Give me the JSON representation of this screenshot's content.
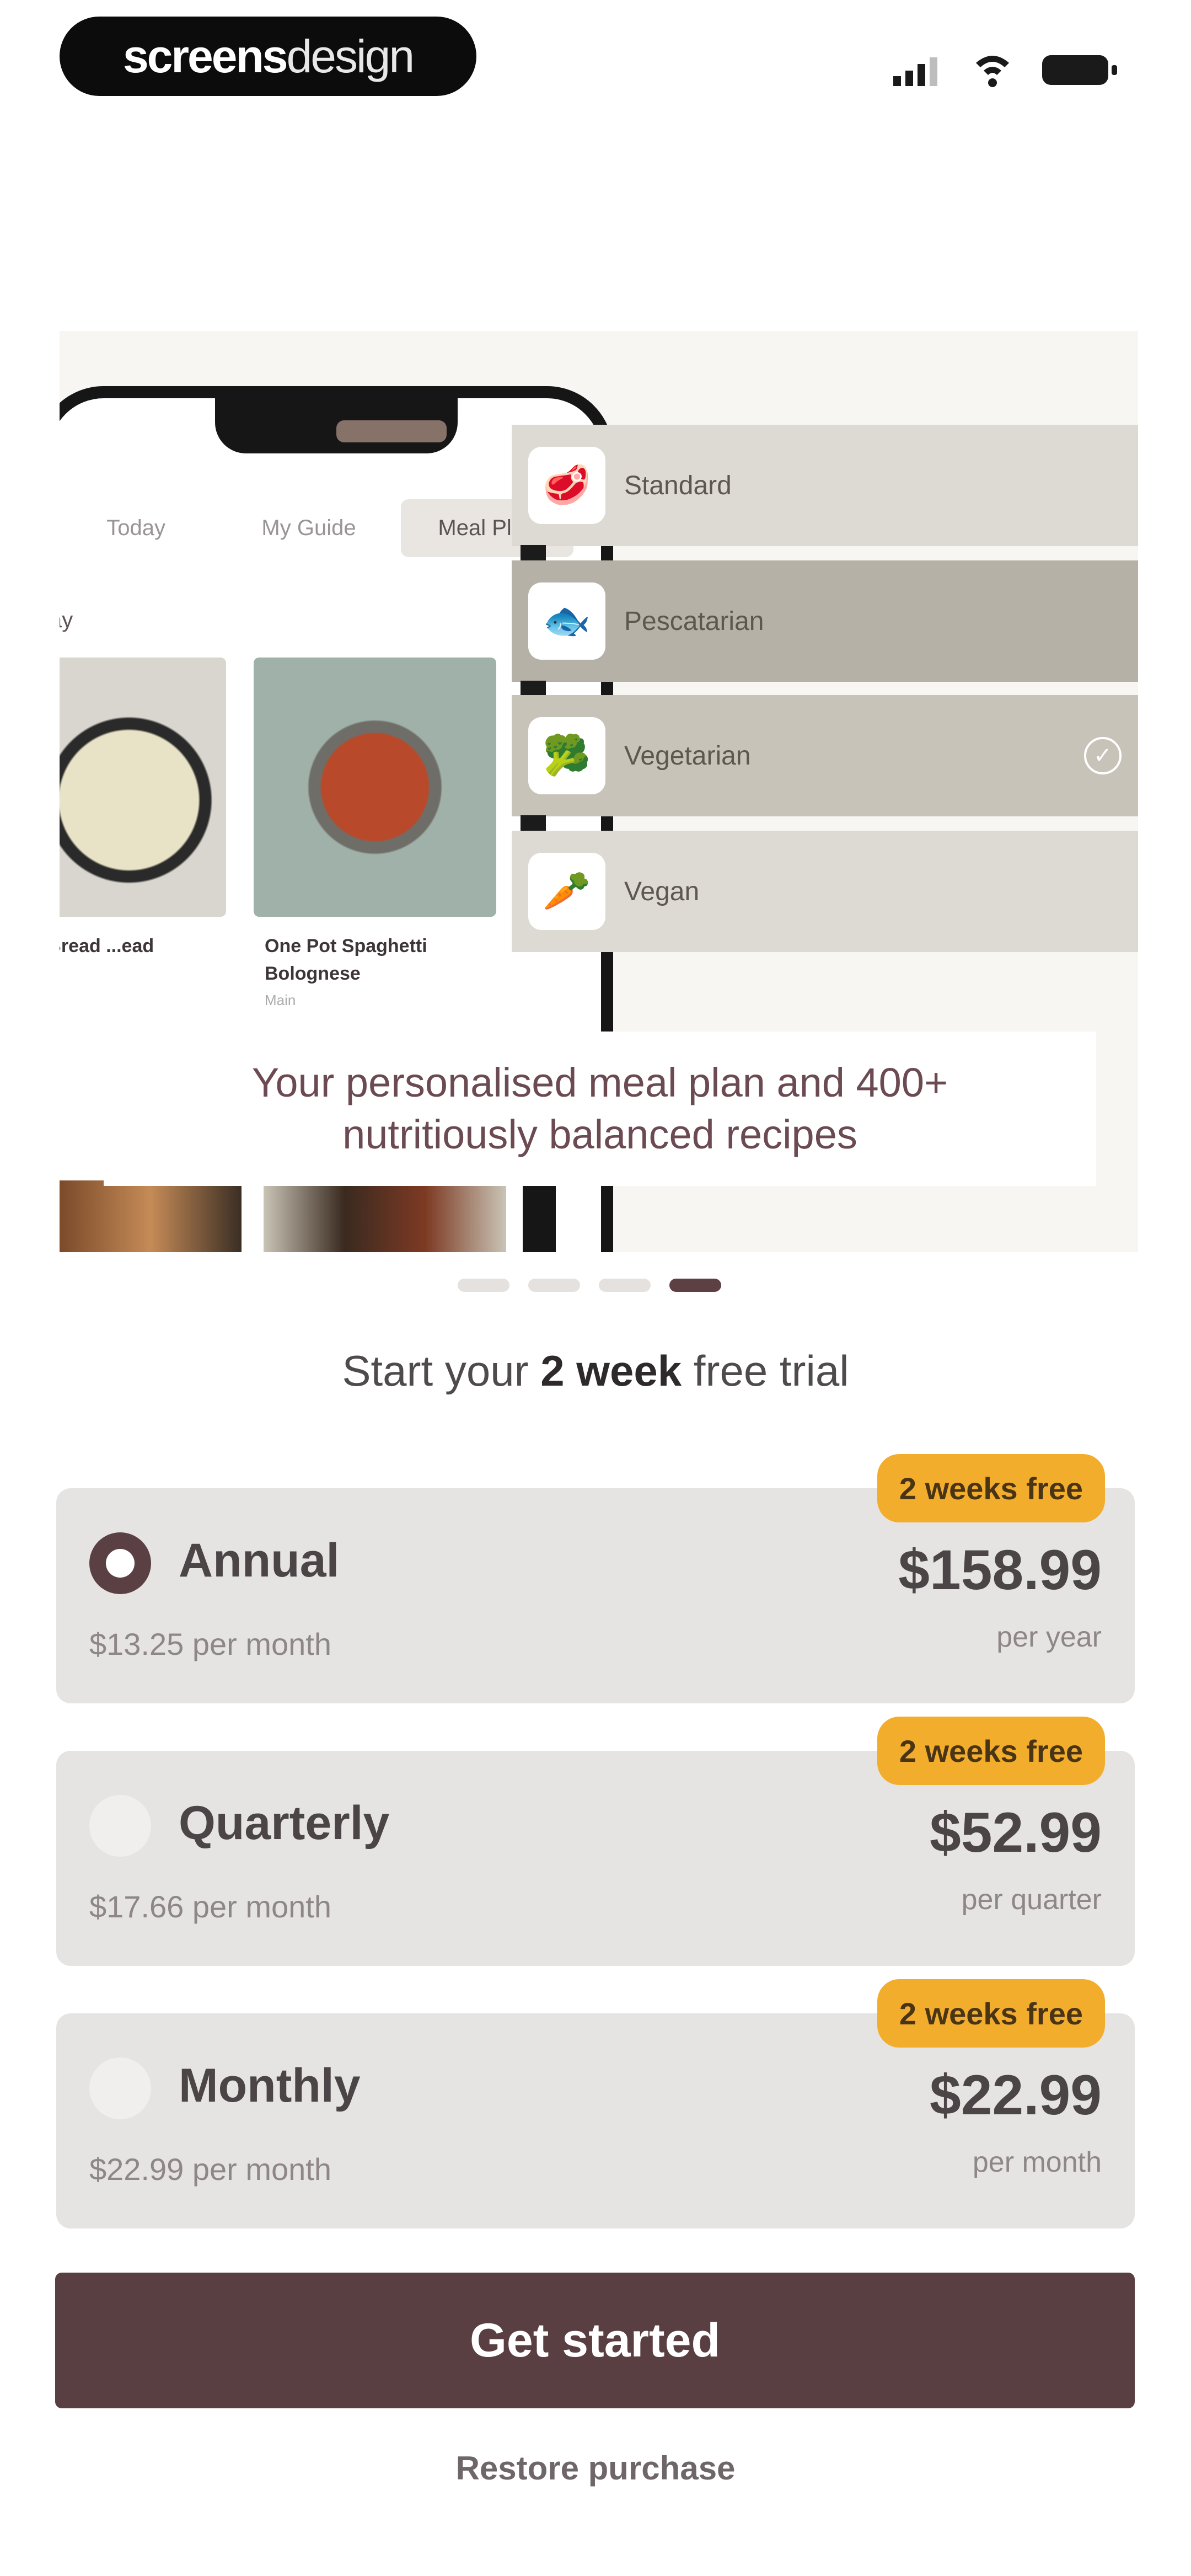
{
  "status_bar": {
    "brand_bold": "screens",
    "brand_light": "design",
    "icons": [
      "signal-icon",
      "wifi-icon",
      "battery-icon"
    ]
  },
  "hero": {
    "phone": {
      "tabs": [
        {
          "label": "Today",
          "active": false
        },
        {
          "label": "My Guide",
          "active": false
        },
        {
          "label": "Meal Plan",
          "active": true
        }
      ],
      "section_label": "ay",
      "cards": [
        {
          "title": "...ans Bread ...ead",
          "meta": "",
          "img_color": "#c9c8a7"
        },
        {
          "title": "One Pot Spaghetti Bolognese",
          "meta": "Main",
          "img_color": "#b04a2c"
        }
      ]
    },
    "diet_options": [
      {
        "label": "Standard",
        "icon": "steak-icon",
        "selected": false
      },
      {
        "label": "Pescatarian",
        "icon": "fish-icon",
        "selected": false
      },
      {
        "label": "Vegetarian",
        "icon": "broccoli-icon",
        "selected": true
      },
      {
        "label": "Vegan",
        "icon": "carrot-icon",
        "selected": false
      }
    ],
    "caption": "Your personalised meal plan and 400+ nutritiously balanced recipes"
  },
  "pagination": {
    "count": 4,
    "active_index": 3
  },
  "trial": {
    "prefix": "Start your ",
    "emphasis": "2 week",
    "suffix": " free trial"
  },
  "plans": [
    {
      "name": "Annual",
      "sub": "$13.25 per month",
      "price": "$158.99",
      "period": "per year",
      "badge": "2 weeks free",
      "selected": true
    },
    {
      "name": "Quarterly",
      "sub": "$17.66 per month",
      "price": "$52.99",
      "period": "per quarter",
      "badge": "2 weeks free",
      "selected": false
    },
    {
      "name": "Monthly",
      "sub": "$22.99 per month",
      "price": "$22.99",
      "period": "per month",
      "badge": "2 weeks free",
      "selected": false
    }
  ],
  "cta_label": "Get started",
  "restore_label": "Restore purchase",
  "colors": {
    "accent": "#5a3f42",
    "badge": "#f2ad2d",
    "plan_bg": "#e6e4e3",
    "caption_text": "#6b4a52"
  }
}
